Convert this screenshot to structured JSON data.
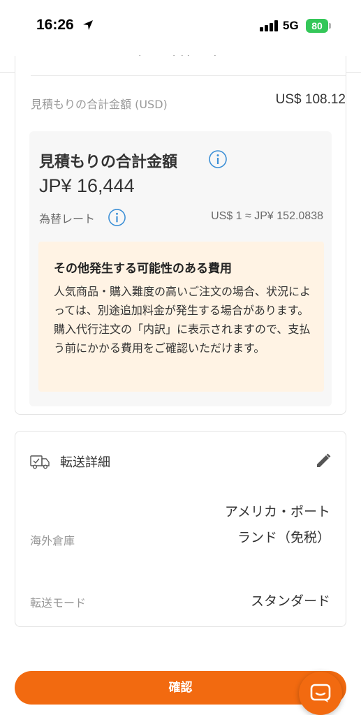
{
  "status_bar": {
    "time": "16:26",
    "network": "5G",
    "battery": "80"
  },
  "browser": {
    "url": "buyandship.co.jp"
  },
  "estimate": {
    "usd_label": "見積もりの合計金額 (USD)",
    "usd_value": "US$ 108.12",
    "total_title": "見積もりの合計金額",
    "total_amount": "JP¥ 16,444",
    "rate_label": "為替レート",
    "rate_value": "US$ 1 ≈ JP¥ 152.0838"
  },
  "notice": {
    "title": "その他発生する可能性のある費用",
    "body": "人気商品・購入難度の高いご注文の場合、状況によっては、別途追加料金が発生する場合があります。購入代行注文の「内訳」に表示されますので、支払う前にかかる費用をご確認いただけます。"
  },
  "forwarding": {
    "title": "転送詳細",
    "warehouse_label": "海外倉庫",
    "warehouse_value": "アメリカ・ポートランド（免税）",
    "mode_label": "転送モード",
    "mode_value": "スタンダード"
  },
  "confirm_label": "確認",
  "colors": {
    "accent": "#f26a10",
    "info": "#3b8fd6",
    "notice_bg": "#fff3e4",
    "battery": "#34c759"
  },
  "icons": [
    "location-arrow-icon",
    "signal-icon",
    "info-icon",
    "truck-icon",
    "edit-pencil-icon",
    "chat-icon"
  ]
}
